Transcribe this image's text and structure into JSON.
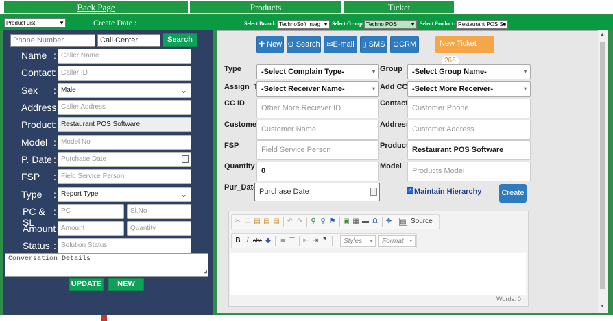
{
  "nav": {
    "back": "Back Page",
    "products": "Products",
    "ticket": "Ticket"
  },
  "subheader": {
    "list_select": "Product List",
    "create_date_label": "Create Date :",
    "brand_label": "Select Brand:",
    "brand_value": "TechnoSoft Integ",
    "group_label": "Select Group:",
    "group_value": "Techno POS",
    "product_label": "Select Product:",
    "product_value": "Restaurant POS So"
  },
  "left": {
    "phone_placeholder": "Phone Number",
    "call_center_value": "Call Center",
    "search_button": "Search",
    "fields": [
      {
        "label": "Name",
        "value": "Caller Name"
      },
      {
        "label": "Contact",
        "value": "Caller ID"
      },
      {
        "label": "Sex",
        "value": "Male"
      },
      {
        "label": "Address",
        "value": "Caller Address"
      },
      {
        "label": "Product",
        "value": "Restaurant POS Software"
      },
      {
        "label": "Model",
        "value": "Model No"
      },
      {
        "label": "P. Date",
        "value": "Purchase Date"
      },
      {
        "label": "FSP",
        "value": "Field Service Person"
      },
      {
        "label": "Type",
        "value": "Report Type"
      },
      {
        "label": "PC & SL",
        "value": "PC",
        "value2": "Sl.No"
      },
      {
        "label": "Amount",
        "value": "Amount",
        "value2": "Quantity"
      },
      {
        "label": "Status",
        "value": "Solution Status"
      }
    ],
    "conversation_placeholder": "Conversation Details",
    "update_button": "UPDATE",
    "new_button": "NEW"
  },
  "actions": {
    "new": "New",
    "search": "Search",
    "email": "E-mail",
    "sms": "SMS",
    "crm": "CRM",
    "new_ticket": "New Ticket",
    "ticket_count": "266"
  },
  "form": {
    "type_label": "Type",
    "type_value": "-Select Complain Type-",
    "group_label": "Group",
    "group_value": "-Select Group Name-",
    "assign_label": "Assign_To",
    "assign_value": "-Select Receiver Name-",
    "addcc_label": "Add CC",
    "addcc_value": "-Select More Receiver-",
    "ccid_label": "CC ID",
    "ccid_placeholder": "Other More Reciever ID",
    "contact_label": "Contact",
    "contact_placeholder": "Customer Phone",
    "customer_label": "Customer",
    "customer_placeholder": "Customer Name",
    "address_label": "Address",
    "address_placeholder": "Customer Address",
    "fsp_label": "FSP",
    "fsp_placeholder": "Field Service Person",
    "products_label": "Products",
    "products_value": "Restaurant POS Software",
    "quantity_label": "Quantity",
    "quantity_value": "0",
    "model_label": "Model",
    "model_placeholder": "Products Model",
    "purdate_label": "Pur_Date",
    "purdate_placeholder": "Purchase Date",
    "maintain_label": "Maintain Hierarchy",
    "create_button": "Create"
  },
  "editor": {
    "source_label": "Source",
    "styles_label": "Styles",
    "format_label": "Format",
    "words_label": "Words: 0"
  },
  "colors": {
    "green_bar": "#0a9a41",
    "left_panel": "#2e4063",
    "blue_button": "#2f7bc0",
    "ticket_orange": "#f5a649"
  }
}
